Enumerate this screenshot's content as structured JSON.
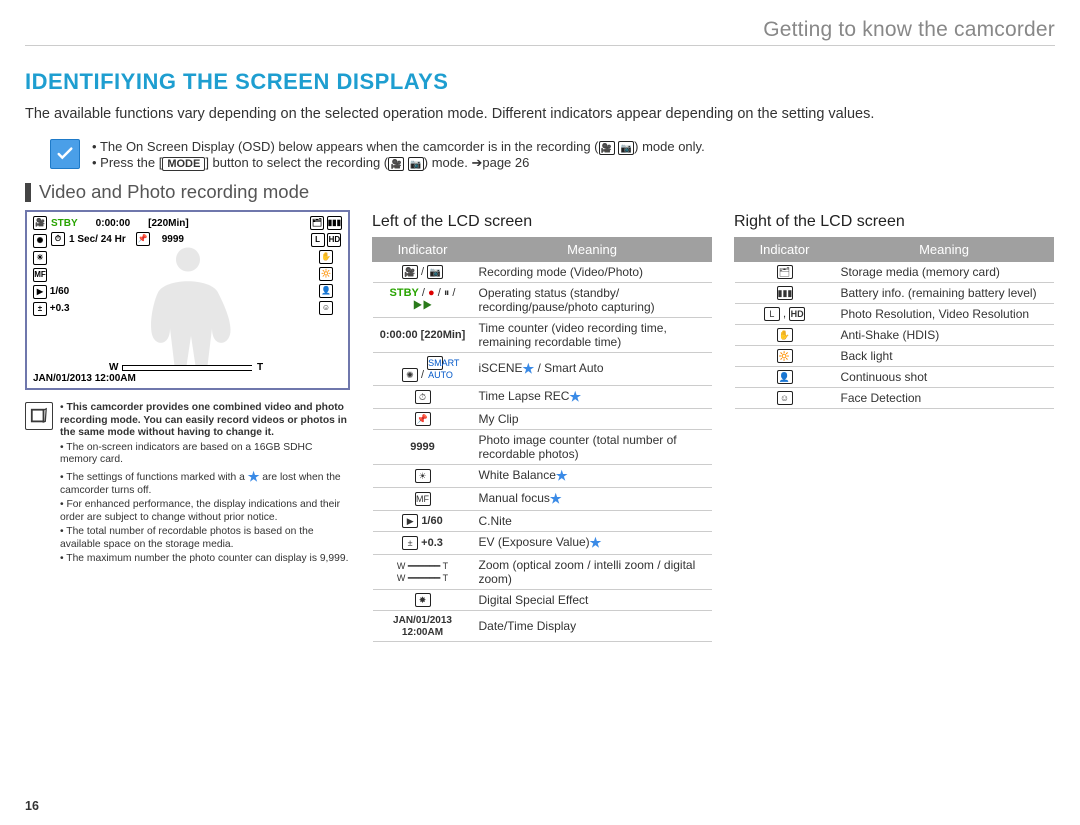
{
  "header": {
    "title": "Getting to know the camcorder"
  },
  "section_title": "IDENTIFIYING THE SCREEN DISPLAYS",
  "intro": "The available functions vary depending on the selected operation mode. Different indicators appear depending on the setting values.",
  "topnote": {
    "line1_a": "The On Screen Display (OSD) below appears when the camcorder is in the recording (",
    "line1_b": ") mode only.",
    "line2_a": "Press the [",
    "line2_mode": "MODE",
    "line2_b": "] button to select the recording (",
    "line2_c": ") mode. ",
    "line2_ref": "page 26"
  },
  "subheading": "Video and Photo recording mode",
  "lcd": {
    "stby": "STBY",
    "time": "0:00:00",
    "remain": "[220Min]",
    "lapse": "1 Sec/ 24 Hr",
    "photos": "9999",
    "cnite": "1/60",
    "ev": "+0.3",
    "w": "W",
    "t": "T",
    "datetime": "JAN/01/2013 12:00AM"
  },
  "belownotes": {
    "n1": "This camcorder provides one combined video and photo recording mode. You can easily record videos or photos in the same mode without having to change it.",
    "n2": "The on-screen indicators are based on a 16GB SDHC memory card.",
    "n3a": "The settings of functions marked with a ",
    "n3b": " are lost when the camcorder turns off.",
    "n4": "For enhanced performance, the display indications and their order are subject to change without prior notice.",
    "n5": "The total number of recordable photos is based on the available space on the storage media.",
    "n6": "The maximum number the photo counter can display is 9,999."
  },
  "left_table": {
    "title": "Left of the LCD screen",
    "col1": "Indicator",
    "col2": "Meaning",
    "rows": [
      {
        "ind_html": "<span class='ico16'>🎥</span> / <span class='ico16'>📷</span>",
        "mean": "Recording mode (Video/Photo)"
      },
      {
        "ind_html": "<span class='stby bold'>STBY</span> / <span style='color:#d00'>●</span> / <span>⏸</span> / <span style='color:#2a7a1a'>▶▶</span>",
        "mean": "Operating status (standby/ recording/pause/photo capturing)"
      },
      {
        "ind_html": "<b>0:00:00 [220Min]</b>",
        "mean": "Time counter (video recording time, remaining recordable time)"
      },
      {
        "ind_html": "<span class='ico16'>✺</span> / <span class='ico16' style='color:#0057c8'>SMART<br>AUTO</span>",
        "mean": "iSCENE★ / Smart Auto",
        "star": true
      },
      {
        "ind_html": "<span class='ico16'>⏱</span>",
        "mean": "Time Lapse REC★",
        "star": true
      },
      {
        "ind_html": "<span class='ico16'>📌</span>",
        "mean": "My Clip"
      },
      {
        "ind_html": "<b>9999</b>",
        "mean": "Photo image counter (total number of recordable photos)"
      },
      {
        "ind_html": "<span class='ico16'>☀</span>",
        "mean": "White Balance★",
        "star": true
      },
      {
        "ind_html": "<span class='ico16'>MF</span>",
        "mean": "Manual focus★",
        "star": true
      },
      {
        "ind_html": "<span class='ico16'>▶</span> <b>1/60</b>",
        "mean": "C.Nite"
      },
      {
        "ind_html": "<span class='ico16'>±</span> <b>+0.3</b>",
        "mean": "EV (Exposure Value)★",
        "star": true
      },
      {
        "ind_html": "<span style='font-size:9px'>W ━━━━━━ T<br>W ━━━━━━ T</span>",
        "mean": "Zoom (optical zoom / intelli zoom / digital zoom)"
      },
      {
        "ind_html": "<span class='ico16'>✸</span>",
        "mean": "Digital Special Effect"
      },
      {
        "ind_html": "<b style='font-size:10px'>JAN/01/2013 12:00AM</b>",
        "mean": "Date/Time Display"
      }
    ]
  },
  "right_table": {
    "title": "Right of the LCD screen",
    "col1": "Indicator",
    "col2": "Meaning",
    "rows": [
      {
        "ind_html": "<span class='ico16'>🗂</span>",
        "mean": "Storage media (memory card)"
      },
      {
        "ind_html": "<span class='ico16'>▮▮▮</span>",
        "mean": "Battery info. (remaining battery level)"
      },
      {
        "ind_html": "<span class='ico16'>L</span> , <span class='ico16'><b>HD</b></span>",
        "mean": "Photo Resolution, Video Resolution"
      },
      {
        "ind_html": "<span class='ico16'>✋</span>",
        "mean": "Anti-Shake (HDIS)"
      },
      {
        "ind_html": "<span class='ico16'>🔆</span>",
        "mean": "Back light"
      },
      {
        "ind_html": "<span class='ico16'>👤</span>",
        "mean": "Continuous shot"
      },
      {
        "ind_html": "<span class='ico16'>☺</span>",
        "mean": "Face Detection"
      }
    ]
  },
  "page_number": "16"
}
